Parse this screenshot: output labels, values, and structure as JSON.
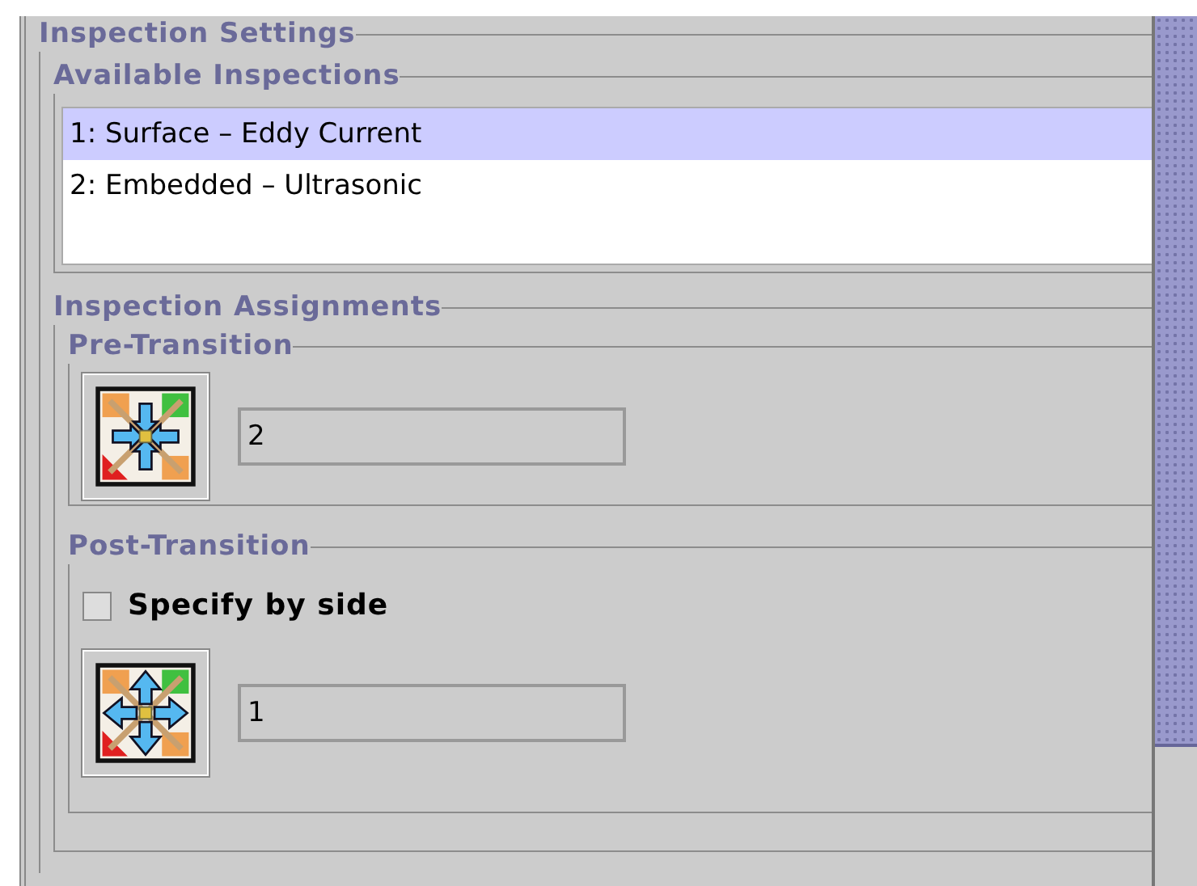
{
  "inspection_settings": {
    "title": "Inspection Settings",
    "available_inspections": {
      "title": "Available Inspections",
      "items": [
        {
          "label": "1: Surface – Eddy Current",
          "selected": true
        },
        {
          "label": "2: Embedded – Ultrasonic",
          "selected": false
        }
      ]
    },
    "inspection_assignments": {
      "title": "Inspection Assignments",
      "pre_transition": {
        "title": "Pre-Transition",
        "value": "2"
      },
      "post_transition": {
        "title": "Post-Transition",
        "checkbox": {
          "label": "Specify by side",
          "checked": false
        },
        "value": "1"
      }
    }
  }
}
